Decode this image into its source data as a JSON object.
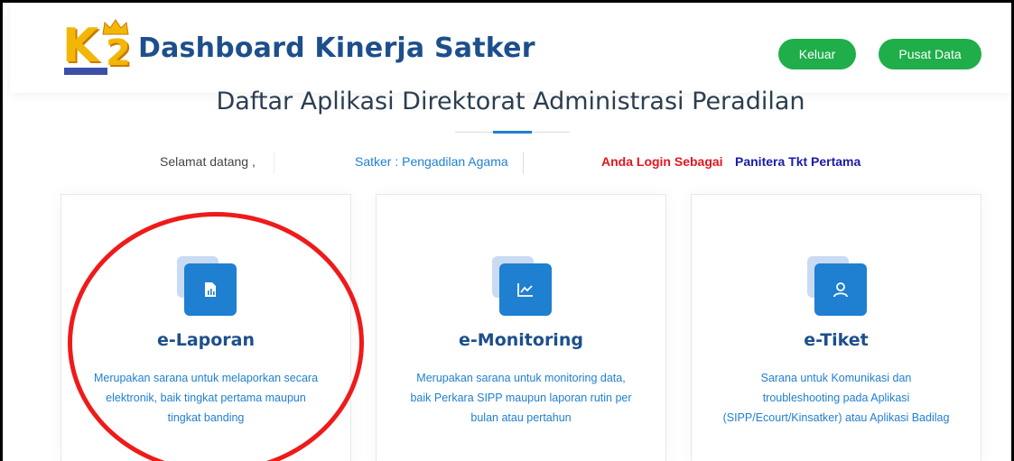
{
  "header": {
    "title": "Dashboard Kinerja Satker",
    "logo_icon": "k2-crown-logo-icon",
    "logout_label": "Keluar",
    "datacenter_label": "Pusat Data"
  },
  "main": {
    "section_title": "Daftar Aplikasi Direktorat Administrasi Peradilan",
    "welcome": {
      "greeting": "Selamat datang ,",
      "satker": "Satker : Pengadilan Agama",
      "login_as": "Anda Login Sebagai",
      "role": "Panitera Tkt Pertama"
    },
    "cards": [
      {
        "title": "e-Laporan",
        "icon": "report-document-icon",
        "desc": [
          "Merupakan sarana untuk melaporkan secara",
          "elektronik, baik tingkat pertama maupun",
          "tingkat banding"
        ]
      },
      {
        "title": "e-Monitoring",
        "icon": "line-chart-icon",
        "desc": [
          "Merupakan sarana untuk monitoring data,",
          "baik Perkara SIPP maupun laporan rutin per",
          "bulan atau pertahun"
        ]
      },
      {
        "title": "e-Tiket",
        "icon": "user-icon",
        "desc": [
          "Sarana untuk Komunikasi dan",
          "troubleshooting pada Aplikasi",
          "(SIPP/Ecourt/Kinsatker) atau Aplikasi Badilag"
        ]
      }
    ]
  },
  "colors": {
    "brand": "#1d4f8c",
    "accent": "#1f7fd1",
    "button": "#1fae4a",
    "login_warning": "#e4151f",
    "role": "#1a1aa8",
    "annotation": "#ef1a1a"
  }
}
